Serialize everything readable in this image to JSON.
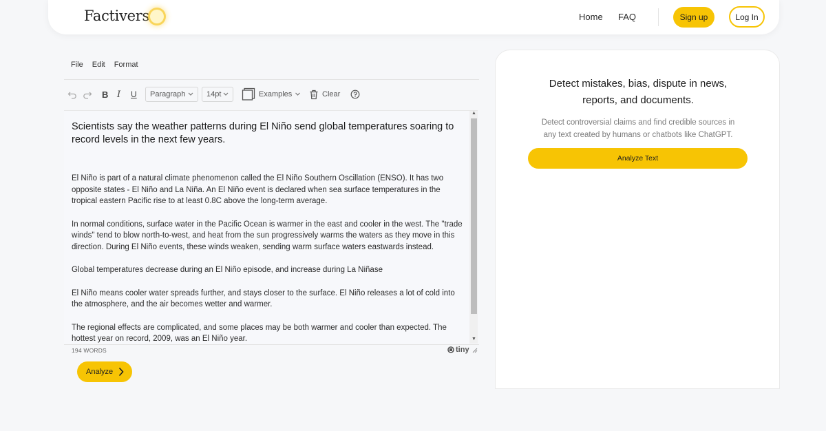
{
  "header": {
    "logo_text": "Factiverse",
    "nav": {
      "home": "Home",
      "faq": "FAQ"
    },
    "signup_label": "Sign up",
    "login_label": "Log In",
    "accent_color": "#f7c404"
  },
  "editor": {
    "menu": {
      "file": "File",
      "edit": "Edit",
      "format": "Format"
    },
    "toolbar": {
      "undo_icon": "undo-icon",
      "redo_icon": "redo-icon",
      "bold": "B",
      "italic": "I",
      "underline": "U",
      "block_format": "Paragraph",
      "font_size": "14pt",
      "examples_label": "Examples",
      "clear_label": "Clear",
      "help_icon": "help-icon"
    },
    "document": {
      "title": "Scientists say the weather patterns during El Niño send global temperatures soaring to record levels in the next few years.",
      "paragraphs": [
        "El Niño is part of a natural climate phenomenon called the El Niño Southern Oscillation (ENSO). It has two opposite states - El Niño and La Niña. An El Niño event is declared when sea surface temperatures in the tropical eastern Pacific rise to at least 0.8C above the long-term average.",
        "In normal conditions, surface water in the Pacific Ocean is warmer in the east and cooler in the west. The \"trade winds\" tend to blow north-to-west, and heat from the sun progressively warms the waters as they move in this direction. During El Niño events, these winds weaken, sending warm surface waters eastwards instead.",
        "Global temperatures decrease during an El Niño episode, and increase during La Niñase",
        "El Niño means cooler water spreads further, and stays closer to the surface. El Niño releases a lot of cold into the atmosphere, and the air becomes wetter and warmer.",
        "The regional effects are complicated, and some places may be both warmer and cooler than expected. The hottest year on record, 2009, was an El Niño year."
      ]
    },
    "status": {
      "word_count": "194 WORDS",
      "brand": "tiny"
    },
    "analyze_label": "Analyze"
  },
  "panel": {
    "title_line1": "Detect mistakes, bias, dispute in news,",
    "title_line2": "reports, and documents.",
    "subtitle_line1": "Detect controversial claims and find credible sources in",
    "subtitle_line2": "any text created by humans or chatbots like ChatGPT.",
    "button_label": "Analyze Text"
  }
}
